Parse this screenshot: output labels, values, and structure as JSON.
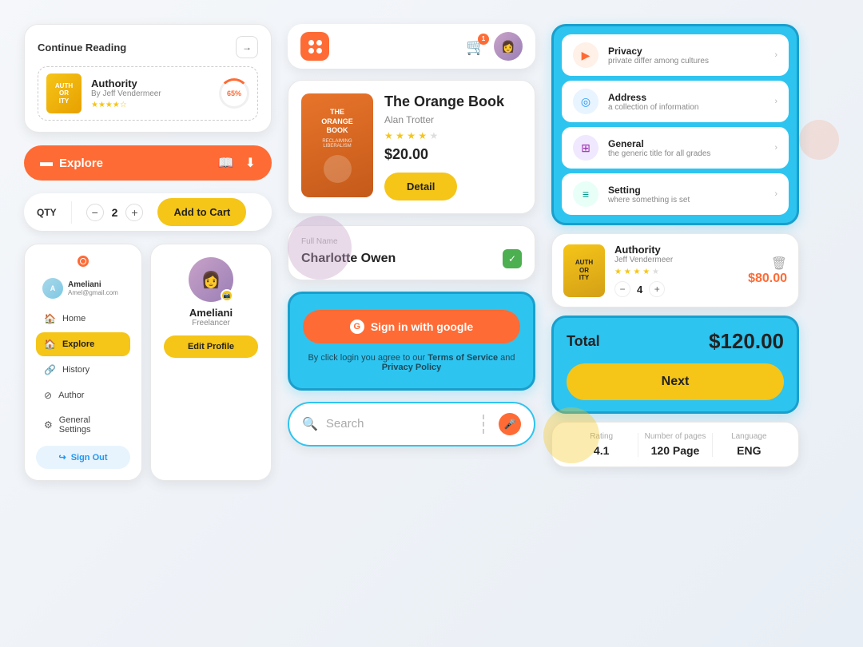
{
  "continueReading": {
    "header": "Continue Reading",
    "book": {
      "title": "Authority",
      "author": "By Jeff Vendermeer",
      "progress": "65%",
      "stars": "★★★★☆",
      "thumbText": "AUTH\nORITY"
    }
  },
  "exploreBar": {
    "label": "Explore"
  },
  "qtyCart": {
    "label": "QTY",
    "quantity": "2",
    "addToCart": "Add to Cart"
  },
  "sidebar": {
    "user": {
      "name": "Ameliani",
      "email": "Amel@gmail.com"
    },
    "navItems": [
      {
        "label": "Home",
        "icon": "🏠",
        "active": false
      },
      {
        "label": "Explore",
        "icon": "🏷",
        "active": true
      },
      {
        "label": "History",
        "icon": "🔗",
        "active": false
      },
      {
        "label": "Author",
        "icon": "⊘",
        "active": false
      },
      {
        "label": "General Settings",
        "icon": "⚙",
        "active": false
      }
    ],
    "signOut": "Sign Out"
  },
  "profile": {
    "name": "Ameliani",
    "role": "Freelancer",
    "editBtn": "Edit Profile"
  },
  "header": {
    "cartCount": "1"
  },
  "bookProduct": {
    "title": "The Orange Book",
    "author": "Alan Trotter",
    "stars": 4,
    "price": "$20.00",
    "detailBtn": "Detail",
    "coverLines": [
      "THE",
      "ORANGE",
      "BOOK",
      "RECLAIMING LIBERALISM"
    ]
  },
  "form": {
    "label": "Full Name",
    "value": "Charlotte Owen"
  },
  "googleSignin": {
    "btnLabel": "Sign in with google",
    "terms": "By click login you agree to our ",
    "termsLink": "Terms of Service",
    "and": " and ",
    "privacyLink": "Privacy Policy"
  },
  "search": {
    "placeholder": "Search"
  },
  "settings": {
    "items": [
      {
        "title": "Privacy",
        "sub": "private differ among cultures",
        "iconType": "orange",
        "icon": "▶"
      },
      {
        "title": "Address",
        "sub": "a collection of information",
        "iconType": "blue",
        "icon": "◎"
      },
      {
        "title": "General",
        "sub": "the generic title for all grades",
        "iconType": "purple",
        "icon": "⊞"
      },
      {
        "title": "Setting",
        "sub": "where something is set",
        "iconType": "teal",
        "icon": "≡"
      }
    ]
  },
  "cartItem": {
    "title": "Authority",
    "author": "Jeff Vendermeer",
    "stars": 4,
    "quantity": "4",
    "price": "$80.00",
    "thumbText": "AUTH\nORITY"
  },
  "total": {
    "label": "Total",
    "amount": "$120.00",
    "nextBtn": "Next"
  },
  "bookStats": {
    "rating": {
      "label": "Rating",
      "value": "4.1"
    },
    "pages": {
      "label": "Number of pages",
      "value": "120 Page"
    },
    "language": {
      "label": "Language",
      "value": "ENG"
    }
  }
}
